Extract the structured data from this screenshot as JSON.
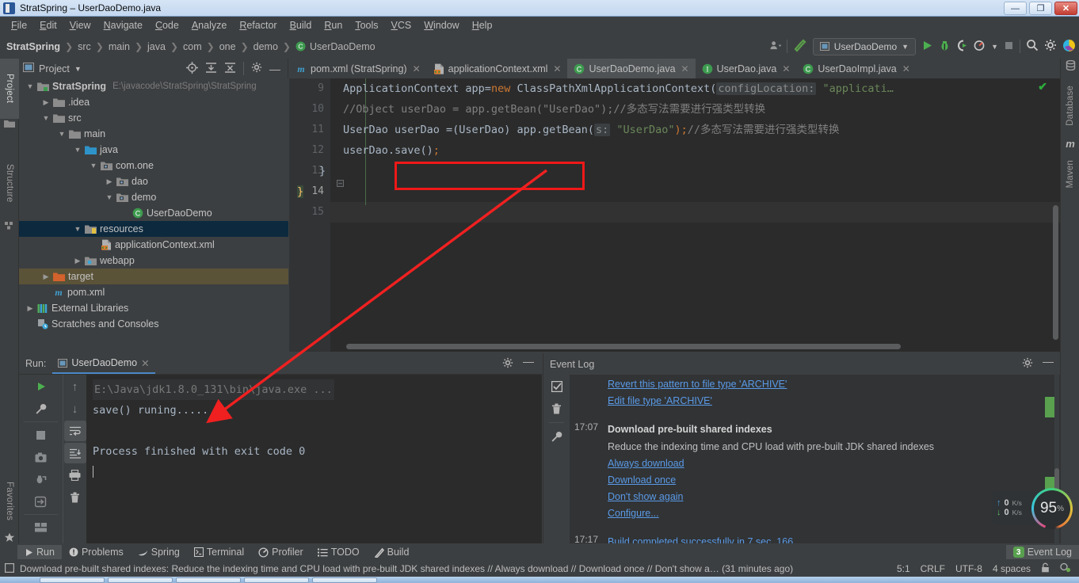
{
  "window": {
    "title": "StratSpring – UserDaoDemo.java",
    "minimize": "—",
    "maximize": "❐",
    "close": "✕"
  },
  "menubar": [
    {
      "label": "File"
    },
    {
      "label": "Edit"
    },
    {
      "label": "View"
    },
    {
      "label": "Navigate"
    },
    {
      "label": "Code"
    },
    {
      "label": "Analyze"
    },
    {
      "label": "Refactor"
    },
    {
      "label": "Build"
    },
    {
      "label": "Run"
    },
    {
      "label": "Tools"
    },
    {
      "label": "VCS"
    },
    {
      "label": "Window"
    },
    {
      "label": "Help"
    }
  ],
  "navbar": {
    "crumbs": [
      "StratSpring",
      "src",
      "main",
      "java",
      "com",
      "one",
      "demo",
      "UserDaoDemo"
    ],
    "run_config": "UserDaoDemo",
    "icons": [
      "user-icon",
      "hammer-icon",
      "run-icon",
      "debug-icon",
      "coverage-icon",
      "profile-icon",
      "stop-icon",
      "search-icon",
      "settings-icon",
      "idea-logo"
    ]
  },
  "left_strip": [
    {
      "label": "Project",
      "icon": "project-icon",
      "active": true
    },
    {
      "label": "Structure",
      "icon": "structure-icon",
      "active": false
    },
    {
      "label": "Favorites",
      "icon": "star-icon",
      "active": false
    }
  ],
  "right_strip": [
    {
      "label": "Database",
      "icon": "database-icon"
    },
    {
      "label": "Maven",
      "icon": "maven-icon"
    }
  ],
  "project": {
    "title": "Project",
    "toolbar_icons": [
      "locate-icon",
      "expand-all-icon",
      "collapse-all-icon",
      "gear-icon",
      "minimize-icon"
    ],
    "tree": [
      {
        "indent": 0,
        "arrow": "v",
        "icon": "module-icon",
        "name": "StratSpring",
        "bold": true,
        "path": "E:\\javacode\\StratSpring\\StratSpring",
        "sel": ""
      },
      {
        "indent": 1,
        "arrow": ">",
        "icon": "folder-icon",
        "name": ".idea",
        "bold": false,
        "path": "",
        "sel": ""
      },
      {
        "indent": 1,
        "arrow": "v",
        "icon": "folder-icon",
        "name": "src",
        "bold": false,
        "path": "",
        "sel": ""
      },
      {
        "indent": 2,
        "arrow": "v",
        "icon": "folder-icon",
        "name": "main",
        "bold": false,
        "path": "",
        "sel": ""
      },
      {
        "indent": 3,
        "arrow": "v",
        "icon": "source-root-icon",
        "name": "java",
        "bold": false,
        "path": "",
        "sel": ""
      },
      {
        "indent": 4,
        "arrow": "v",
        "icon": "package-icon",
        "name": "com.one",
        "bold": false,
        "path": "",
        "sel": ""
      },
      {
        "indent": 5,
        "arrow": ">",
        "icon": "package-icon",
        "name": "dao",
        "bold": false,
        "path": "",
        "sel": ""
      },
      {
        "indent": 5,
        "arrow": "v",
        "icon": "package-icon",
        "name": "demo",
        "bold": false,
        "path": "",
        "sel": ""
      },
      {
        "indent": 6,
        "arrow": "",
        "icon": "class-icon",
        "name": "UserDaoDemo",
        "bold": false,
        "path": "",
        "sel": ""
      },
      {
        "indent": 3,
        "arrow": "v",
        "icon": "resource-root-icon",
        "name": "resources",
        "bold": false,
        "path": "",
        "sel": "blue"
      },
      {
        "indent": 4,
        "arrow": "",
        "icon": "xml-icon",
        "name": "applicationContext.xml",
        "bold": false,
        "path": "",
        "sel": ""
      },
      {
        "indent": 3,
        "arrow": ">",
        "icon": "webapp-icon",
        "name": "webapp",
        "bold": false,
        "path": "",
        "sel": ""
      },
      {
        "indent": 1,
        "arrow": ">",
        "icon": "target-folder-icon",
        "name": "target",
        "bold": false,
        "path": "",
        "sel": "tan"
      },
      {
        "indent": 1,
        "arrow": "",
        "icon": "maven-icon",
        "name": "pom.xml",
        "bold": false,
        "path": "",
        "sel": ""
      },
      {
        "indent": 0,
        "arrow": ">",
        "icon": "libraries-icon",
        "name": "External Libraries",
        "bold": false,
        "path": "",
        "sel": ""
      },
      {
        "indent": 0,
        "arrow": "",
        "icon": "scratches-icon",
        "name": "Scratches and Consoles",
        "bold": false,
        "path": "",
        "sel": ""
      }
    ]
  },
  "editor": {
    "tabs": [
      {
        "label": "pom.xml (StratSpring)",
        "icon": "maven-icon",
        "active": false
      },
      {
        "label": "applicationContext.xml",
        "icon": "xml-icon",
        "active": false
      },
      {
        "label": "UserDaoDemo.java",
        "icon": "class-icon",
        "active": true
      },
      {
        "label": "UserDao.java",
        "icon": "interface-icon",
        "active": false
      },
      {
        "label": "UserDaoImpl.java",
        "icon": "class-icon",
        "active": false
      }
    ],
    "line_numbers": [
      "9",
      "10",
      "11",
      "12",
      "13",
      "14",
      "15"
    ],
    "current_line": "14",
    "code_lines": [
      {
        "n": "9",
        "segments": [
          {
            "t": "ApplicationContext app=",
            "c": "plain"
          },
          {
            "t": "new",
            "c": "kw"
          },
          {
            "t": " ClassPathXmlApplicationContext(",
            "c": "plain"
          },
          {
            "t": "configLocation:",
            "c": "hint"
          },
          {
            "t": " \"applicati…",
            "c": "str"
          }
        ]
      },
      {
        "n": "10",
        "segments": [
          {
            "t": "//Object userDao = app.getBean(\"UserDao\");//多态写法需要进行强类型转换",
            "c": "cm"
          }
        ]
      },
      {
        "n": "11",
        "segments": [
          {
            "t": "UserDao userDao =(UserDao) app.getBean(",
            "c": "plain"
          },
          {
            "t": "s:",
            "c": "hint"
          },
          {
            "t": " \"UserDao\"",
            "c": "str"
          },
          {
            "t": ");",
            "c": "semi"
          },
          {
            "t": "//多态写法需要进行强类型转换",
            "c": "cm"
          }
        ]
      },
      {
        "n": "12",
        "segments": [
          {
            "t": "userDao.save()",
            "c": "plain"
          },
          {
            "t": ";",
            "c": "semi"
          }
        ]
      },
      {
        "n": "13",
        "segments": [
          {
            "t": "}",
            "c": "plain"
          }
        ]
      },
      {
        "n": "14",
        "segments": [
          {
            "t": "}",
            "c": "brace-yellow"
          }
        ]
      },
      {
        "n": "15",
        "segments": []
      }
    ],
    "highlight_box_label": "userDao.save();",
    "inspection_status": "check-ok"
  },
  "run_panel": {
    "label": "Run:",
    "tab": "UserDaoDemo",
    "tab_close": "✕",
    "toolbar_icons": [
      "rerun-icon",
      "settings-wrench-icon",
      "stop-icon",
      "camera-icon",
      "dump-threads-icon",
      "export-icon",
      "layout-icon",
      "more-icon"
    ],
    "toolbar2_icons": [
      "up-arrow-icon",
      "down-arrow-icon",
      "soft-wrap-icon",
      "scroll-to-end-icon",
      "print-icon",
      "trash-icon"
    ],
    "head_icons": [
      "gear-icon",
      "minimize-icon"
    ],
    "console_lines": [
      {
        "text": "E:\\Java\\jdk1.8.0_131\\bin\\java.exe ...",
        "style": "dim"
      },
      {
        "text": "save() runing.....",
        "style": "normal"
      },
      {
        "text": "",
        "style": "normal"
      },
      {
        "text": "Process finished with exit code 0",
        "style": "normal"
      },
      {
        "text": "",
        "style": "caret"
      }
    ]
  },
  "event_log": {
    "title": "Event Log",
    "head_icons": [
      "gear-icon",
      "minimize-icon"
    ],
    "toolbar_icons": [
      "mark-read-icon",
      "trash-icon",
      "wrench-icon"
    ],
    "entries": [
      {
        "time": "",
        "links": [
          "Revert this pattern to file type 'ARCHIVE'",
          "Edit file type 'ARCHIVE'"
        ],
        "title": "",
        "desc": "",
        "mark": true
      },
      {
        "time": "17:07",
        "links": [
          "Always download",
          "Download once",
          "Don't show again",
          "Configure..."
        ],
        "title": "Download pre-built shared indexes",
        "desc": "Reduce the indexing time and CPU load with pre-built JDK shared indexes",
        "mark": true
      },
      {
        "time": "17:17",
        "links": [],
        "title": "",
        "desc": "Build completed successfully in 7 sec, 166…",
        "mark": false
      }
    ]
  },
  "bottom_tabs": [
    {
      "label": "Run",
      "icon": "run-icon",
      "active": true
    },
    {
      "label": "Problems",
      "icon": "problems-icon",
      "active": false
    },
    {
      "label": "Spring",
      "icon": "spring-icon",
      "active": false
    },
    {
      "label": "Terminal",
      "icon": "terminal-icon",
      "active": false
    },
    {
      "label": "Profiler",
      "icon": "profiler-icon",
      "active": false
    },
    {
      "label": "TODO",
      "icon": "todo-icon",
      "active": false
    },
    {
      "label": "Build",
      "icon": "build-icon",
      "active": false
    }
  ],
  "bottom_right_tab": {
    "label": "Event Log",
    "badge": "3",
    "icon": "event-log-icon"
  },
  "status_bar": {
    "message": "Download pre-built shared indexes: Reduce the indexing time and CPU load with pre-built JDK shared indexes // Always download // Download once // Don't show a… (31 minutes ago)",
    "message_icon": "notification-icon",
    "caret": "5:1",
    "line_sep": "CRLF",
    "encoding": "UTF-8",
    "indent": "4 spaces",
    "icons": [
      "lock-icon",
      "inspections-icon"
    ]
  },
  "widgets": {
    "net_up": "0",
    "net_up_unit": "K/s",
    "net_down": "0",
    "net_down_unit": "K/s",
    "cpu_value": "95",
    "cpu_unit": "%"
  },
  "colors": {
    "accent_blue": "#4a88c7",
    "link_blue": "#5a9ae6",
    "annotation_red": "#f01818",
    "green_ok": "#59a14f",
    "panel_bg": "#3c3f41",
    "editor_bg": "#2b2b2b"
  }
}
